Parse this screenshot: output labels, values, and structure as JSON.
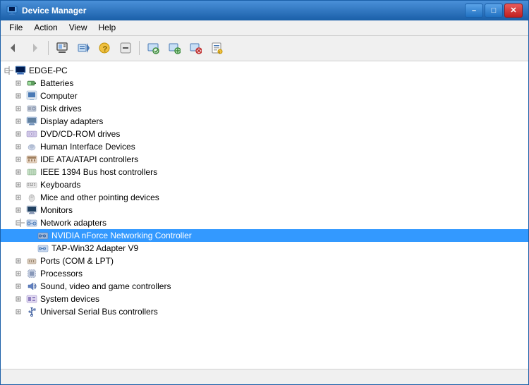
{
  "window": {
    "title": "Device Manager",
    "icon": "device-manager-icon"
  },
  "title_buttons": {
    "minimize": "–",
    "maximize": "□",
    "close": "✕"
  },
  "menu": {
    "items": [
      "File",
      "Action",
      "View",
      "Help"
    ]
  },
  "toolbar": {
    "buttons": [
      {
        "icon": "◀",
        "name": "back-btn"
      },
      {
        "icon": "▶",
        "name": "forward-btn"
      },
      {
        "sep": true
      },
      {
        "icon": "⊞",
        "name": "properties-btn"
      },
      {
        "icon": "⊟",
        "name": "update-driver-btn"
      },
      {
        "icon": "?",
        "name": "help-btn"
      },
      {
        "icon": "⊟",
        "name": "btn4"
      },
      {
        "sep": true
      },
      {
        "icon": "↺",
        "name": "scan-btn"
      },
      {
        "icon": "⊕",
        "name": "add-btn"
      },
      {
        "icon": "✕",
        "name": "remove-btn"
      },
      {
        "icon": "✦",
        "name": "properties2-btn"
      }
    ]
  },
  "tree": {
    "root": {
      "label": "EDGE-PC",
      "expanded": true,
      "children": [
        {
          "label": "Batteries",
          "icon": "battery",
          "expanded": false
        },
        {
          "label": "Computer",
          "icon": "computer",
          "expanded": false
        },
        {
          "label": "Disk drives",
          "icon": "disk",
          "expanded": false
        },
        {
          "label": "Display adapters",
          "icon": "display",
          "expanded": false
        },
        {
          "label": "DVD/CD-ROM drives",
          "icon": "dvd",
          "expanded": false
        },
        {
          "label": "Human Interface Devices",
          "icon": "hid",
          "expanded": false
        },
        {
          "label": "IDE ATA/ATAPI controllers",
          "icon": "ide",
          "expanded": false
        },
        {
          "label": "IEEE 1394 Bus host controllers",
          "icon": "ieee",
          "expanded": false
        },
        {
          "label": "Keyboards",
          "icon": "keyboard",
          "expanded": false
        },
        {
          "label": "Mice and other pointing devices",
          "icon": "mouse",
          "expanded": false
        },
        {
          "label": "Monitors",
          "icon": "monitor",
          "expanded": false
        },
        {
          "label": "Network adapters",
          "icon": "network",
          "expanded": true,
          "children": [
            {
              "label": "NVIDIA nForce Networking Controller",
              "icon": "network-device",
              "selected": true
            },
            {
              "label": "TAP-Win32 Adapter V9",
              "icon": "network-device"
            }
          ]
        },
        {
          "label": "Ports (COM & LPT)",
          "icon": "port",
          "expanded": false
        },
        {
          "label": "Processors",
          "icon": "processor",
          "expanded": false
        },
        {
          "label": "Sound, video and game controllers",
          "icon": "sound",
          "expanded": false
        },
        {
          "label": "System devices",
          "icon": "system",
          "expanded": false
        },
        {
          "label": "Universal Serial Bus controllers",
          "icon": "usb",
          "expanded": false
        }
      ]
    }
  },
  "status_bar": {
    "text": ""
  }
}
